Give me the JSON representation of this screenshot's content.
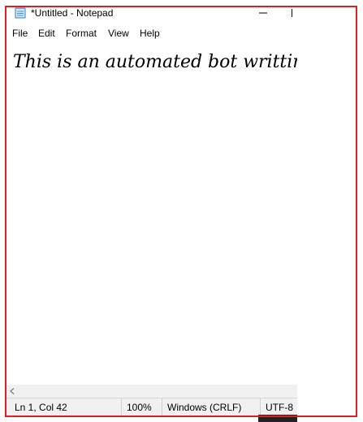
{
  "window": {
    "title": "*Untitled - Notepad"
  },
  "titlebar": {
    "app_icon": "notepad-icon",
    "minimize_icon": "minimize-icon",
    "maximize_icon": "maximize-icon"
  },
  "menu": {
    "items": [
      {
        "label": "File"
      },
      {
        "label": "Edit"
      },
      {
        "label": "Format"
      },
      {
        "label": "View"
      },
      {
        "label": "Help"
      }
    ]
  },
  "editor": {
    "text": "This is an automated bot writting fo"
  },
  "scrollbar": {
    "left_arrow_icon": "scroll-left-icon"
  },
  "status": {
    "position": "Ln 1, Col 42",
    "zoom": "100%",
    "line_endings": "Windows (CRLF)",
    "encoding": "UTF-8"
  },
  "colors": {
    "highlight": "#e02020",
    "statusbar_bg": "#f0f0f0"
  }
}
